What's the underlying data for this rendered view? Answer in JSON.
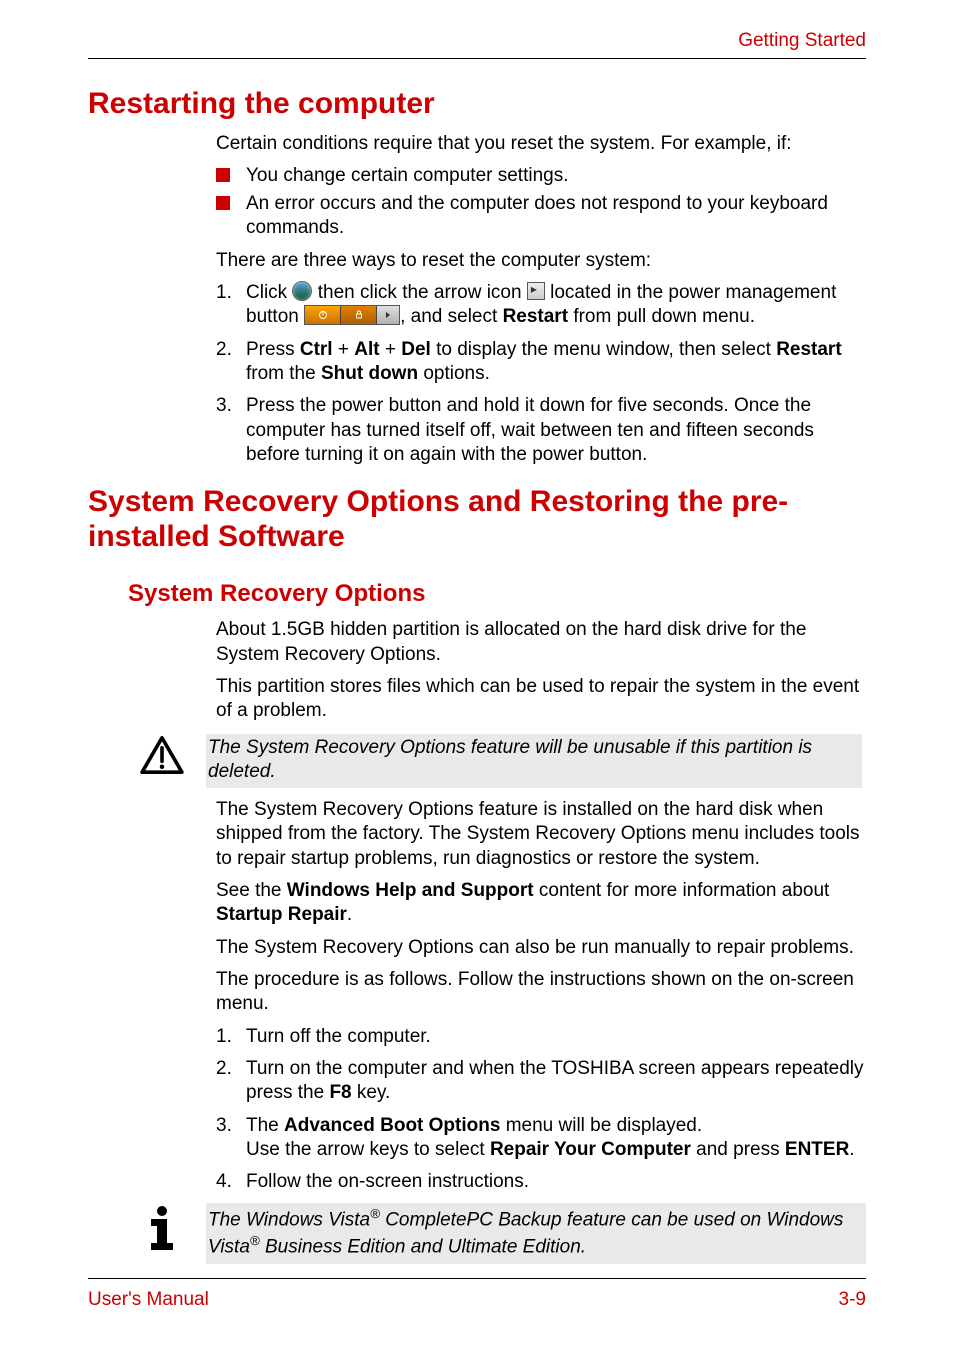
{
  "header": {
    "section": "Getting Started"
  },
  "h1_restart": "Restarting the computer",
  "restart_intro": "Certain conditions require that you reset the system. For example, if:",
  "restart_bullets": [
    "You change certain computer settings.",
    "An error occurs and the computer does not respond to your keyboard commands."
  ],
  "restart_threeways": "There are three ways to reset the computer system:",
  "restart_steps": {
    "s1_a": "Click ",
    "s1_b": " then click the arrow icon ",
    "s1_c": " located in the power management button ",
    "s1_d": ", and select ",
    "s1_restart": "Restart",
    "s1_e": " from pull down menu.",
    "s2_a": "Press ",
    "s2_ctrl": "Ctrl",
    "s2_plus": " + ",
    "s2_alt": "Alt",
    "s2_del": "Del",
    "s2_b": " to display the menu window, then select ",
    "s2_restart": "Restart",
    "s2_c": " from the ",
    "s2_shutdown": "Shut down",
    "s2_d": " options.",
    "s3": "Press the power button and hold it down for five seconds. Once the computer has turned itself off, wait between ten and fifteen seconds before turning it on again with the power button."
  },
  "h1_recovery": "System Recovery Options and Restoring the pre-installed Software",
  "h2_recovery": "System Recovery Options",
  "recovery_p1": "About 1.5GB hidden partition is allocated on the hard disk drive for the System Recovery Options.",
  "recovery_p2": "This partition stores files which can be used to repair the system in the event of a problem.",
  "warn_text": "The System Recovery Options feature will be unusable if this partition is deleted.",
  "recovery_p3": "The System Recovery Options feature is installed on the hard disk when shipped from the factory. The System Recovery Options menu includes tools to repair startup problems, run diagnostics or restore the system.",
  "recovery_p4_a": "See the ",
  "recovery_p4_b": "Windows Help and Support",
  "recovery_p4_c": " content for more information about ",
  "recovery_p4_d": "Startup Repair",
  "recovery_p4_e": ".",
  "recovery_p5": "The System Recovery Options can also be run manually to repair problems.",
  "recovery_p6": "The procedure is as follows. Follow the instructions shown on the on-screen menu.",
  "manual_steps": {
    "s1": "Turn off the computer.",
    "s2_a": "Turn on the computer and when the TOSHIBA screen appears repeatedly press the ",
    "s2_f8": "F8",
    "s2_b": " key.",
    "s3_a": "The ",
    "s3_abo": "Advanced Boot Options",
    "s3_b": " menu will be displayed.",
    "s3_c": "Use the arrow keys to select ",
    "s3_repair": "Repair Your Computer",
    "s3_d": " and press ",
    "s3_enter": "ENTER",
    "s3_e": ".",
    "s4": "Follow the on-screen instructions."
  },
  "note_a": "The Windows Vista",
  "note_reg": "®",
  "note_b": " CompletePC Backup feature can be used on Windows Vista",
  "note_c": " Business Edition and Ultimate Edition.",
  "footer": {
    "left": "User's Manual",
    "right": "3-9"
  }
}
